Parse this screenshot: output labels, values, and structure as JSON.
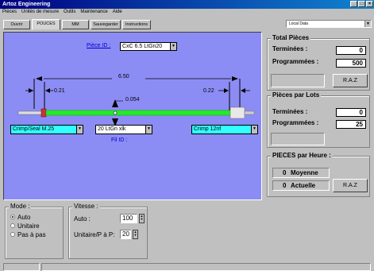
{
  "window": {
    "title": "Artoz Engineering",
    "controls": [
      "_",
      "□",
      "×"
    ]
  },
  "menu": [
    "Pièces",
    "Unités de mesure",
    "Outils",
    "Maintenance",
    "Aide"
  ],
  "toolbar": {
    "tabs": [
      "Ouvrir",
      "POUCES",
      "MM",
      "Sauvegarder",
      "Instructions"
    ],
    "local_data": "Local Data"
  },
  "piece": {
    "label": "Pièce ID :",
    "value": "CxC 6.5 LtGn20",
    "length": "6.50",
    "left_offset": "0.21",
    "right_offset": "0.22",
    "center_gap": "0.054",
    "left_terminal": "Crimp/Seal M.25",
    "wire": "20 LtGn xlk",
    "wire_label": "Fil ID :",
    "right_terminal": "Crimp 12nf"
  },
  "total": {
    "title": "Total Pièces",
    "done_label": "Terminées :",
    "done": "0",
    "prog_label": "Programmées :",
    "prog": "500",
    "reset": "R.A.Z"
  },
  "batch": {
    "title": "Pièces par Lots",
    "done_label": "Terminées :",
    "done": "0",
    "prog_label": "Programmées :",
    "prog": "25"
  },
  "hourly": {
    "title": "PIECES par Heure :",
    "avg": "0",
    "avg_label": "Moyenne",
    "cur": "0",
    "cur_label": "Actuelle",
    "reset": "R.A.Z"
  },
  "mode": {
    "title": "Mode :",
    "options": [
      "Auto",
      "Unitaire",
      "Pas à pas"
    ]
  },
  "speed": {
    "title": "Vitesse :",
    "auto_label": "Auto :",
    "auto_value": "100",
    "unit_label": "Unitaire/P à P:",
    "unit_value": "20"
  },
  "colors": {
    "panel_blue": "#8c8cf5",
    "wire_green": "#22ee22",
    "cyan": "#33ffff"
  }
}
